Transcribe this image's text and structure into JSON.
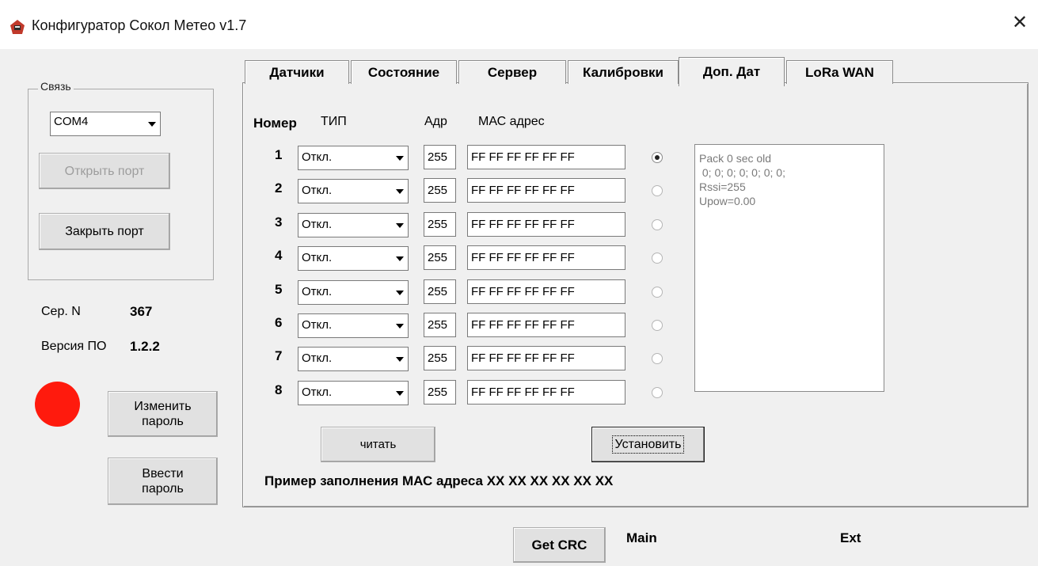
{
  "window": {
    "title": "Конфигуратор Сокол Метео v1.7",
    "app_icon": "app-logo-icon",
    "close_glyph": "✕"
  },
  "connection": {
    "group_label": "Связь",
    "port_value": "COM4",
    "open_port_label": "Открыть порт",
    "close_port_label": "Закрыть порт"
  },
  "device": {
    "serial_label": "Сер. N",
    "serial_value": "367",
    "fw_label": "Версия ПО",
    "fw_value": "1.2.2",
    "status_color": "#ff1a0d",
    "change_password_label": "Изменить\nпароль",
    "enter_password_label": "Ввести\nпароль"
  },
  "tabs": [
    {
      "label": "Датчики"
    },
    {
      "label": "Состояние"
    },
    {
      "label": "Сервер"
    },
    {
      "label": "Калибровки"
    },
    {
      "label": "Доп. Дат",
      "active": true
    },
    {
      "label": "LoRa WAN"
    }
  ],
  "sensors": {
    "headers": {
      "number": "Номер",
      "type": "ТИП",
      "addr": "Адр",
      "mac": "МАС адрес"
    },
    "rows": [
      {
        "num": "1",
        "type": "Откл.",
        "addr": "255",
        "mac": "FF FF FF FF FF FF",
        "selected": true
      },
      {
        "num": "2",
        "type": "Откл.",
        "addr": "255",
        "mac": "FF FF FF FF FF FF",
        "selected": false
      },
      {
        "num": "3",
        "type": "Откл.",
        "addr": "255",
        "mac": "FF FF FF FF FF FF",
        "selected": false
      },
      {
        "num": "4",
        "type": "Откл.",
        "addr": "255",
        "mac": "FF FF FF FF FF FF",
        "selected": false
      },
      {
        "num": "5",
        "type": "Откл.",
        "addr": "255",
        "mac": "FF FF FF FF FF FF",
        "selected": false
      },
      {
        "num": "6",
        "type": "Откл.",
        "addr": "255",
        "mac": "FF FF FF FF FF FF",
        "selected": false
      },
      {
        "num": "7",
        "type": "Откл.",
        "addr": "255",
        "mac": "FF FF FF FF FF FF",
        "selected": false
      },
      {
        "num": "8",
        "type": "Откл.",
        "addr": "255",
        "mac": "FF FF FF FF FF FF",
        "selected": false
      }
    ],
    "read_label": "читать",
    "set_label": "Установить",
    "mac_example": "Пример заполнения МАС адреса XX XX XX XX XX XX",
    "info_text": "Pack 0 sec old\n 0; 0; 0; 0; 0; 0; 0;\nRssi=255\nUpow=0.00"
  },
  "footer": {
    "get_crc_label": "Get CRC",
    "main_label": "Main",
    "ext_label": "Ext"
  }
}
